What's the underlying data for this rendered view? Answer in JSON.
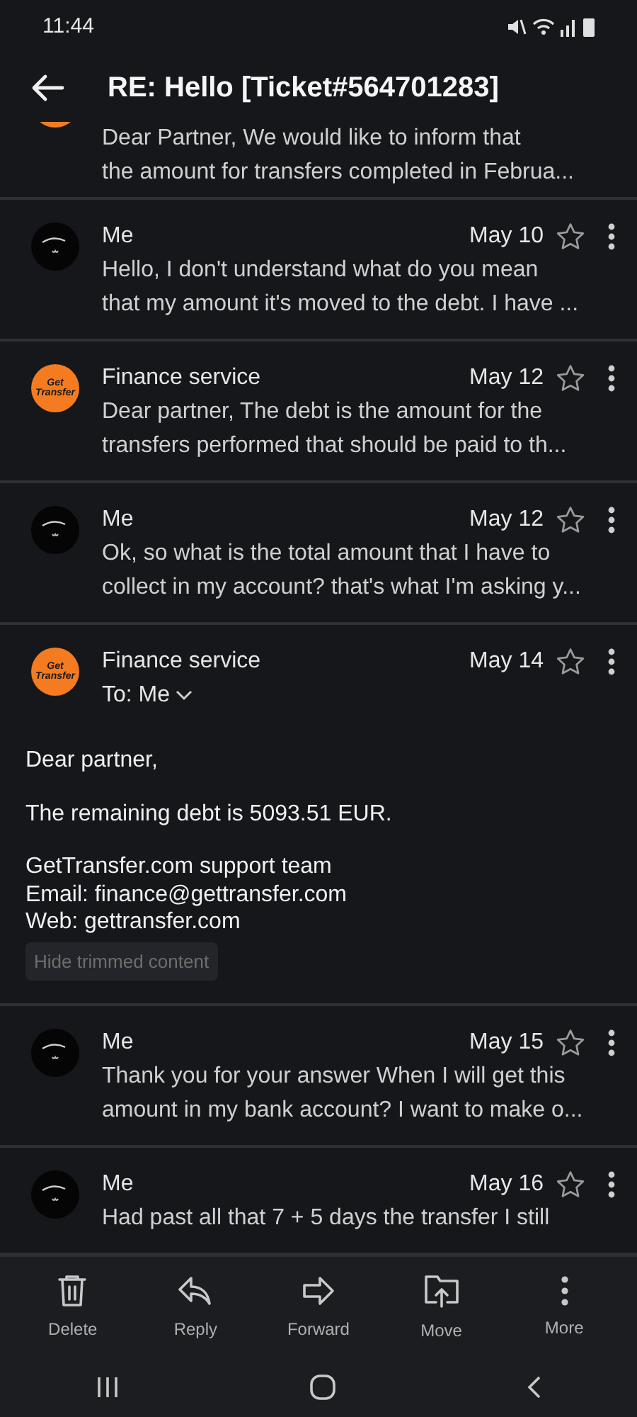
{
  "status_bar": {
    "time": "11:44"
  },
  "header": {
    "title": "RE: Hello [Ticket#564701283]"
  },
  "messages": [
    {
      "kind": "fragment",
      "preview": [
        "Dear Partner, We would like to inform that",
        "the amount for transfers completed in Februa..."
      ]
    },
    {
      "kind": "collapsed",
      "sender": "Me",
      "date": "May 10",
      "starred": false,
      "preview": [
        "Hello, I don't understand what do you mean",
        "that my amount it's moved to the debt. I have ..."
      ]
    },
    {
      "kind": "collapsed",
      "avatar_label": "Get Transfer",
      "sender": "Finance service",
      "date": "May 12",
      "starred": false,
      "preview": [
        "Dear partner, The debt is the amount for the",
        "transfers performed that should be paid to th..."
      ]
    },
    {
      "kind": "collapsed",
      "sender": "Me",
      "date": "May 12",
      "starred": false,
      "preview": [
        "Ok, so what is the total amount that I have to",
        "collect in my account? that's what I'm asking y..."
      ]
    },
    {
      "kind": "expanded",
      "avatar_label": "Get Transfer",
      "sender": "Finance service",
      "date": "May 14",
      "starred": false,
      "recipient": "To: Me",
      "body": [
        [
          "Dear partner,"
        ],
        [
          "The remaining debt is 5093.51 EUR."
        ],
        [
          "GetTransfer.com support team",
          "Email: finance@gettransfer.com",
          "Web: gettransfer.com"
        ]
      ],
      "trim_button": "Hide trimmed content"
    },
    {
      "kind": "collapsed",
      "sender": "Me",
      "date": "May 15",
      "starred": false,
      "preview": [
        "Thank you for your answer When I will get this",
        "amount in my bank account? I want to make o..."
      ]
    },
    {
      "kind": "collapsed",
      "sender": "Me",
      "date": "May 16",
      "starred": false,
      "preview": [
        "Had past all that 7 + 5 days the transfer I still"
      ]
    }
  ],
  "toolbar": [
    {
      "kind": "delete",
      "label": "Delete"
    },
    {
      "kind": "reply",
      "label": "Reply"
    },
    {
      "kind": "forward",
      "label": "Forward"
    },
    {
      "kind": "move",
      "label": "Move"
    },
    {
      "kind": "more",
      "label": "More"
    }
  ]
}
